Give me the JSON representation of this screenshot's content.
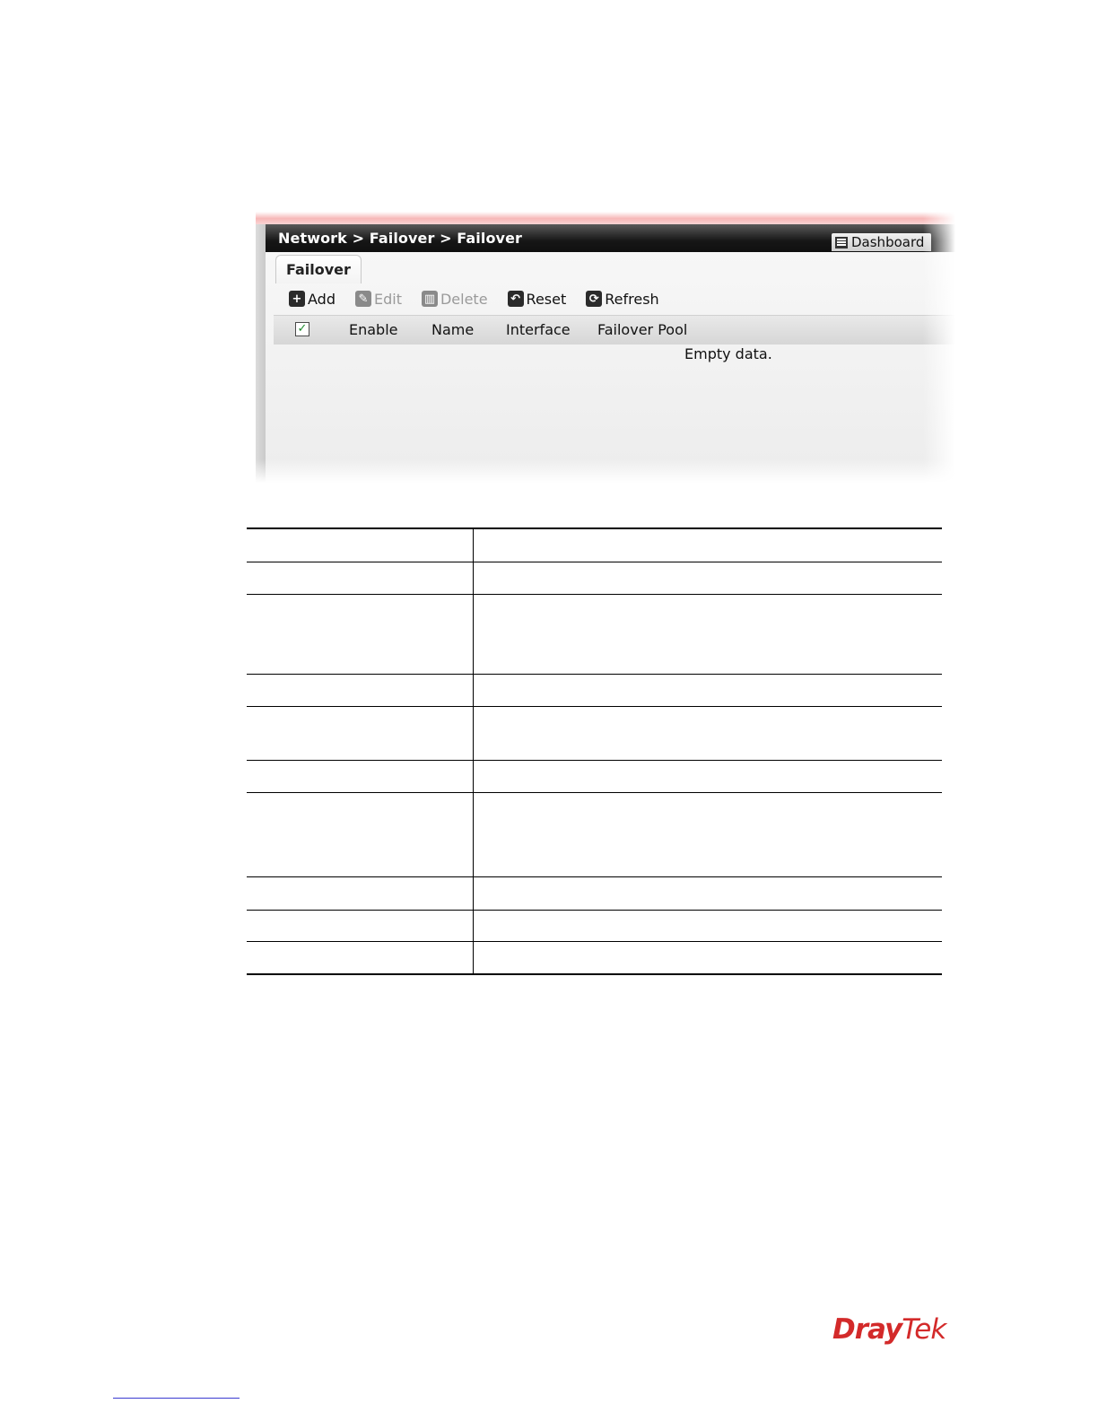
{
  "screenshot": {
    "breadcrumb": "Network > Failover > Failover",
    "dashboard_label": "Dashboard",
    "tab_label": "Failover",
    "toolbar": {
      "add": "Add",
      "edit": "Edit",
      "delete": "Delete",
      "reset": "Reset",
      "refresh": "Refresh"
    },
    "columns": [
      "Enable",
      "Name",
      "Interface",
      "Failover Pool"
    ],
    "empty_message": "Empty data."
  },
  "brand": {
    "logo_part1": "Dray",
    "logo_part2": "Tek",
    "color": "#d32a2a"
  },
  "colors": {
    "titlebar": "#161616",
    "glow": "#f7b7b7"
  }
}
